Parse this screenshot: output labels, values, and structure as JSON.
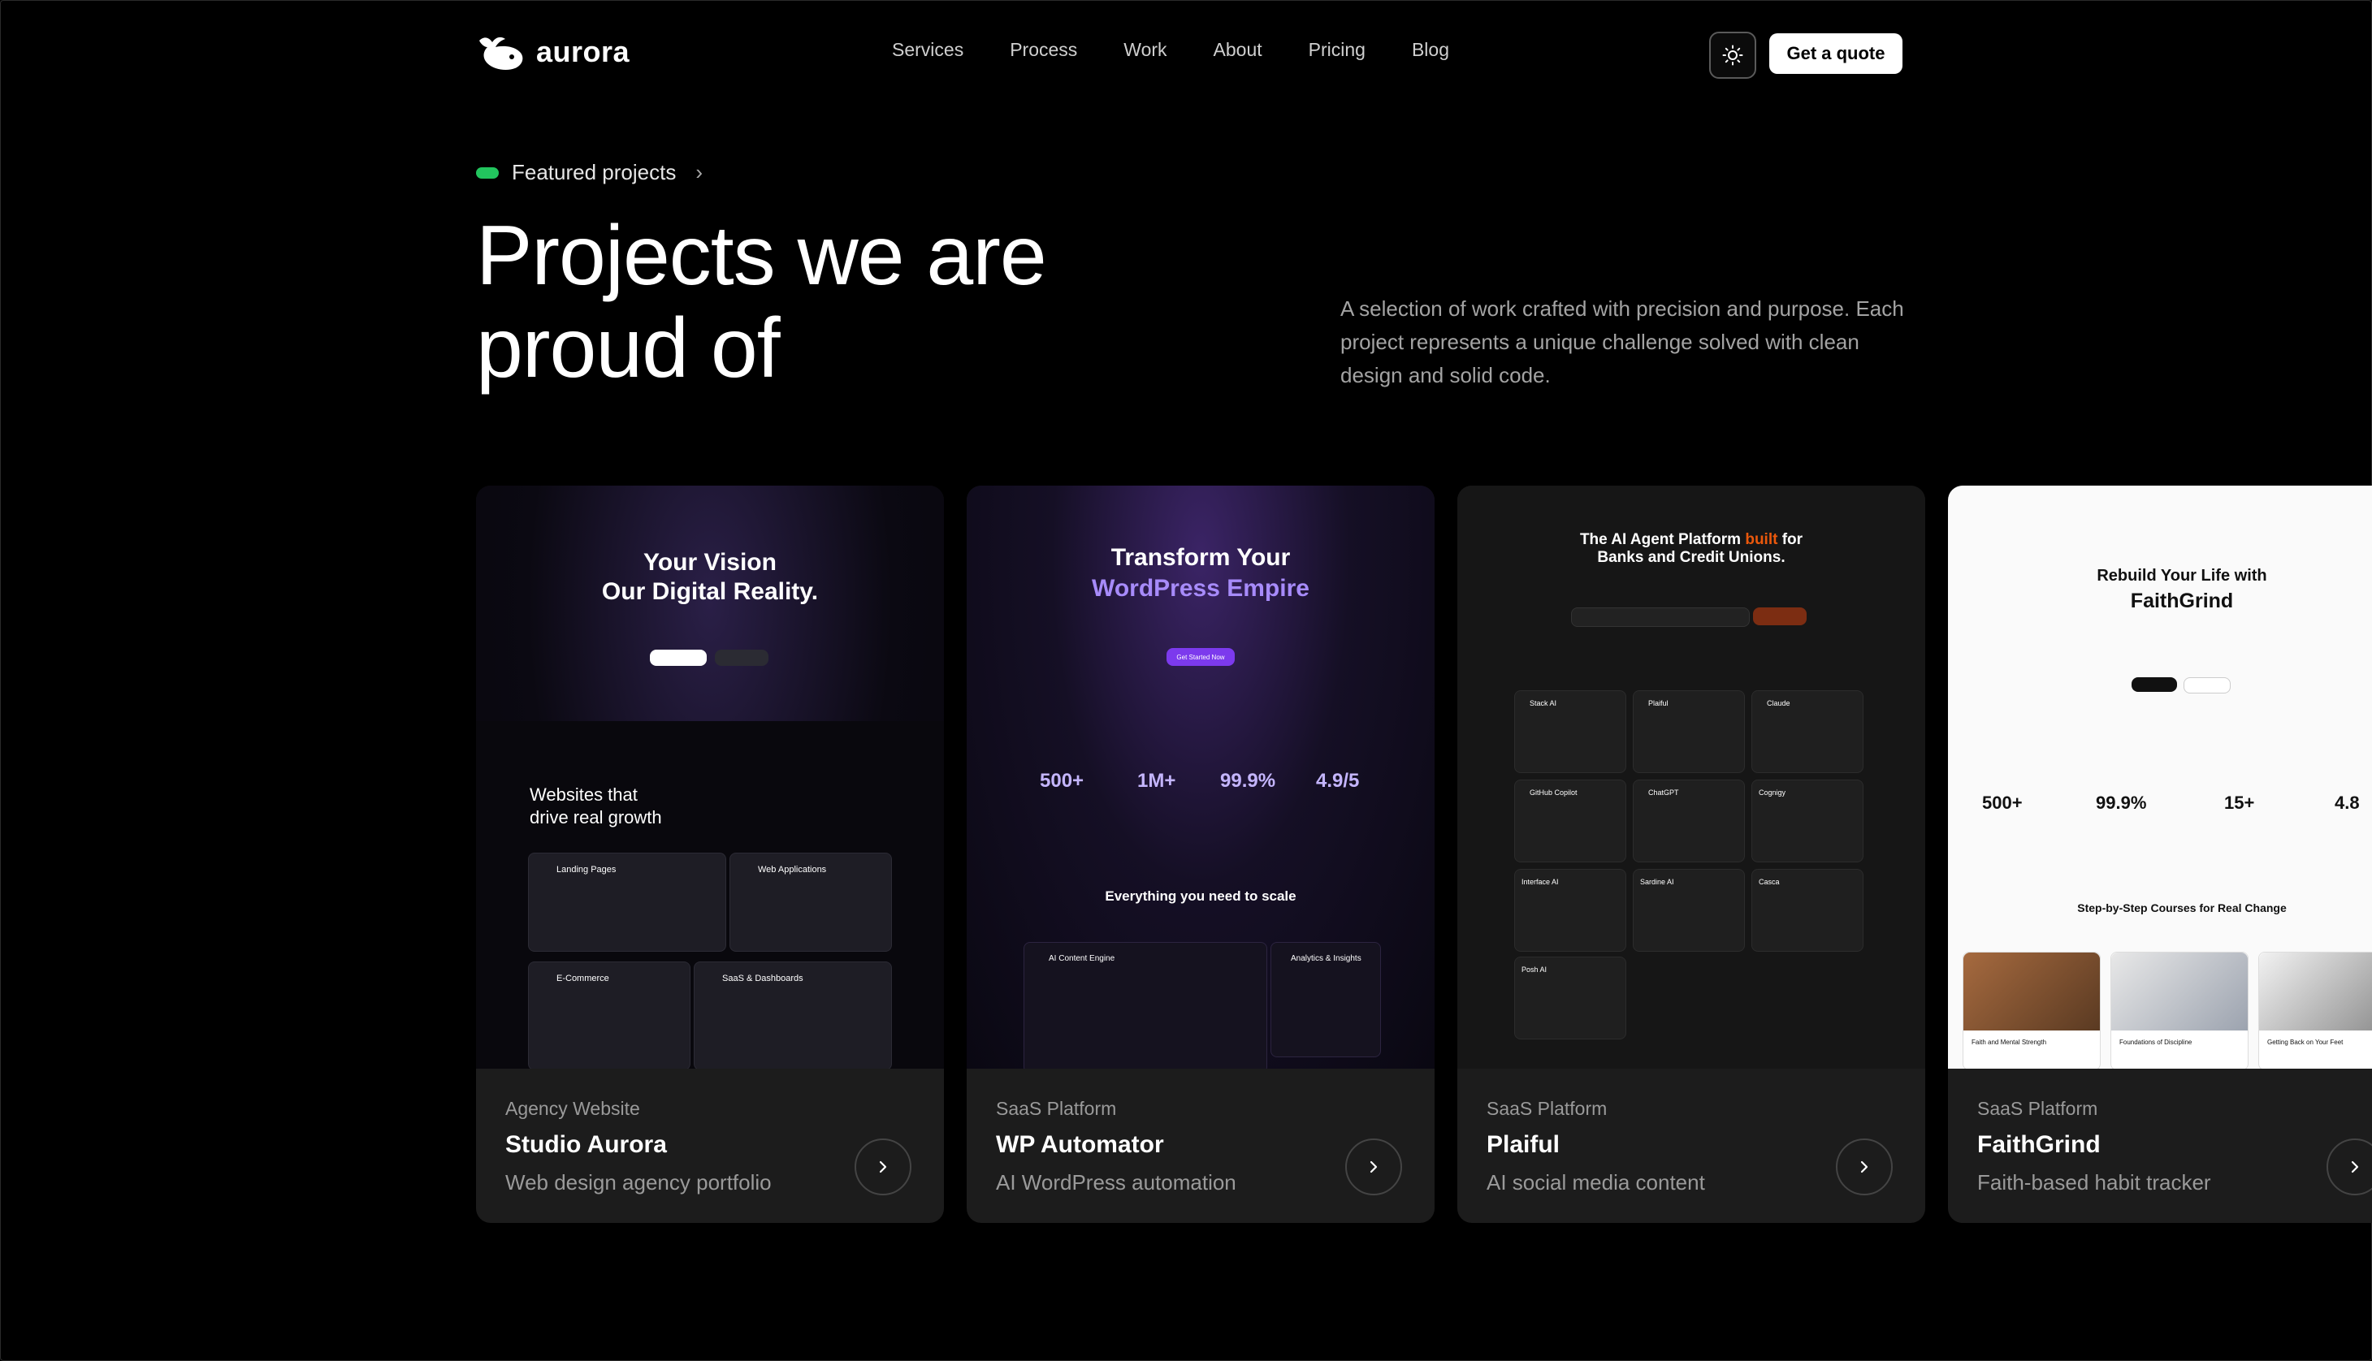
{
  "brand": {
    "name": "aurora"
  },
  "nav": {
    "items": [
      "Services",
      "Process",
      "Work",
      "About",
      "Pricing",
      "Blog"
    ],
    "cta": "Get a quote",
    "theme_icon": "sun-icon"
  },
  "hero": {
    "eyebrow": "Featured projects",
    "title_line1": "Projects we are",
    "title_line2": "proud of",
    "description": "A selection of work crafted with precision and purpose. Each project represents a unique challenge solved with clean design and solid code."
  },
  "colors": {
    "accent": "#22c55e",
    "card_bg": "#1c1c1c",
    "purple": "#7c3aed",
    "orange": "#c2410c"
  },
  "projects": [
    {
      "category": "Agency Website",
      "name": "Studio Aurora",
      "subtitle": "Web design agency portfolio",
      "preview": {
        "headline1": "Your Vision",
        "headline2": "Our Digital Reality.",
        "section1": "Websites that",
        "section2": "drive real growth",
        "tiles": [
          "Landing Pages",
          "Web Applications",
          "E-Commerce",
          "SaaS & Dashboards"
        ]
      }
    },
    {
      "category": "SaaS Platform",
      "name": "WP Automator",
      "subtitle": "AI WordPress automation",
      "preview": {
        "headline1": "Transform Your",
        "headline2": "WordPress Empire",
        "cta": "Get Started Now",
        "stats": [
          "500+",
          "1M+",
          "99.9%",
          "4.9/5"
        ],
        "section": "Everything you need to scale",
        "panel1": "AI Content Engine",
        "panel2": "Analytics & Insights"
      }
    },
    {
      "category": "SaaS Platform",
      "name": "Plaiful",
      "subtitle": "AI social media content",
      "preview": {
        "headline_a": "The AI Agent Platform",
        "headline_b": "built",
        "headline_c": "for",
        "headline2": "Banks and Credit Unions.",
        "tools": [
          "Stack AI",
          "Plaiful",
          "Claude",
          "GitHub Copilot",
          "ChatGPT",
          "Cognigy",
          "Interface AI",
          "Sardine AI",
          "Casca",
          "Posh AI"
        ]
      }
    },
    {
      "category": "SaaS Platform",
      "name": "FaithGrind",
      "subtitle": "Faith-based habit tracker",
      "preview": {
        "headline1": "Rebuild Your Life with",
        "headline2": "FaithGrind",
        "stats": [
          "500+",
          "99.9%",
          "15+",
          "4.8"
        ],
        "section": "Step-by-Step Courses for Real Change",
        "courses": [
          "Faith and Mental Strength",
          "Foundations of Discipline",
          "Getting Back on Your Feet"
        ]
      }
    }
  ]
}
